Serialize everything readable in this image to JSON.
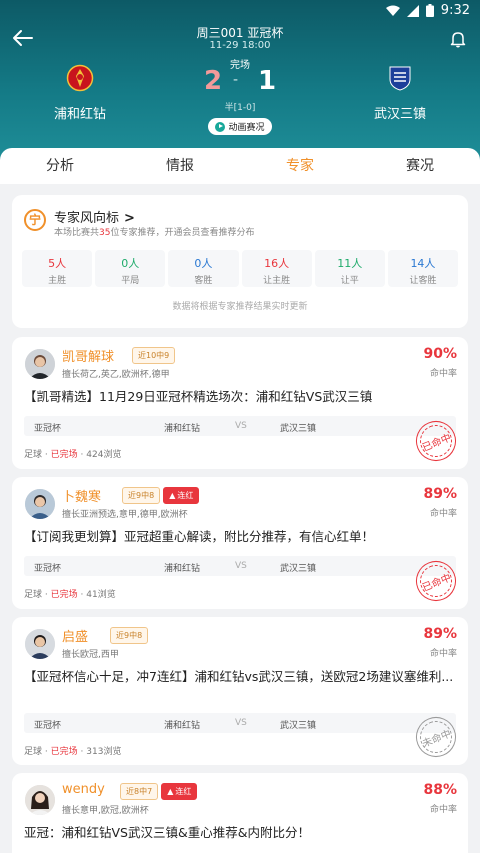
{
  "status_bar": {
    "time": "9:32"
  },
  "match": {
    "title": "周三001 亚冠杯",
    "datetime": "11-29 18:00",
    "status": "完场",
    "home_team": "浦和红钻",
    "away_team": "武汉三镇",
    "home_score": "2",
    "away_score": "1",
    "separator": "-",
    "half_score": "半[1-0]",
    "animation_button": "动画赛况"
  },
  "tabs": [
    "分析",
    "情报",
    "专家",
    "赛况"
  ],
  "active_tab": "专家",
  "wind": {
    "icon_char": "宁",
    "title": "专家风向标",
    "chevron": ">",
    "subtitle_pre": "本场比赛共",
    "subtitle_count": "35",
    "subtitle_post": "位专家推荐，开通会员查看推荐分布",
    "stats": [
      {
        "value": "5人",
        "label": "主胜",
        "color": "red"
      },
      {
        "value": "0人",
        "label": "平局",
        "color": "green"
      },
      {
        "value": "0人",
        "label": "客胜",
        "color": "blue"
      },
      {
        "value": "16人",
        "label": "让主胜",
        "color": "red"
      },
      {
        "value": "11人",
        "label": "让平",
        "color": "green"
      },
      {
        "value": "14人",
        "label": "让客胜",
        "color": "blue"
      }
    ],
    "note": "数据将根据专家推荐结果实时更新"
  },
  "experts": [
    {
      "name": "凯哥解球",
      "badge": "近10中9",
      "streak": "",
      "tags": "擅长荷乙,英乙,欧洲杯,德甲",
      "rate": "90%",
      "rate_label": "命中率",
      "title": "【凯哥精选】11月29日亚冠杯精选场次：浦和红钻VS武汉三镇",
      "league": "亚冠杯",
      "home": "浦和红钻",
      "vs": "VS",
      "away": "武汉三镇",
      "sport": "足球",
      "sep": "·",
      "state": "已完场",
      "views": "424浏览",
      "stamp": "已命中"
    },
    {
      "name": "卜魏寒",
      "badge": "近9中8",
      "streak": "连红",
      "tags": "擅长亚洲预选,意甲,德甲,欧洲杯",
      "rate": "89%",
      "rate_label": "命中率",
      "title": "【订阅我更划算】亚冠超重心解读，附比分推荐，有信心红单！",
      "league": "亚冠杯",
      "home": "浦和红钻",
      "vs": "VS",
      "away": "武汉三镇",
      "sport": "足球",
      "sep": "·",
      "state": "已完场",
      "views": "41浏览",
      "stamp": "已命中"
    },
    {
      "name": "启盛",
      "badge": "近9中8",
      "streak": "",
      "tags": "擅长欧冠,西甲",
      "rate": "89%",
      "rate_label": "命中率",
      "title": "【亚冠杯信心十足，冲7连红】浦和红钻vs武汉三镇，送欧冠2场建议塞维利...",
      "league": "亚冠杯",
      "home": "浦和红钻",
      "vs": "VS",
      "away": "武汉三镇",
      "sport": "足球",
      "sep": "·",
      "state": "已完场",
      "views": "313浏览",
      "stamp": "未命中"
    },
    {
      "name": "wendy",
      "badge": "近8中7",
      "streak": "连红",
      "tags": "擅长意甲,欧冠,欧洲杯",
      "rate": "88%",
      "rate_label": "命中率",
      "title": "亚冠：浦和红钻VS武汉三镇&重心推荐&内附比分！"
    }
  ],
  "colors": {
    "accent": "#f0902a",
    "red": "#e8363d",
    "header": "#147a86"
  }
}
